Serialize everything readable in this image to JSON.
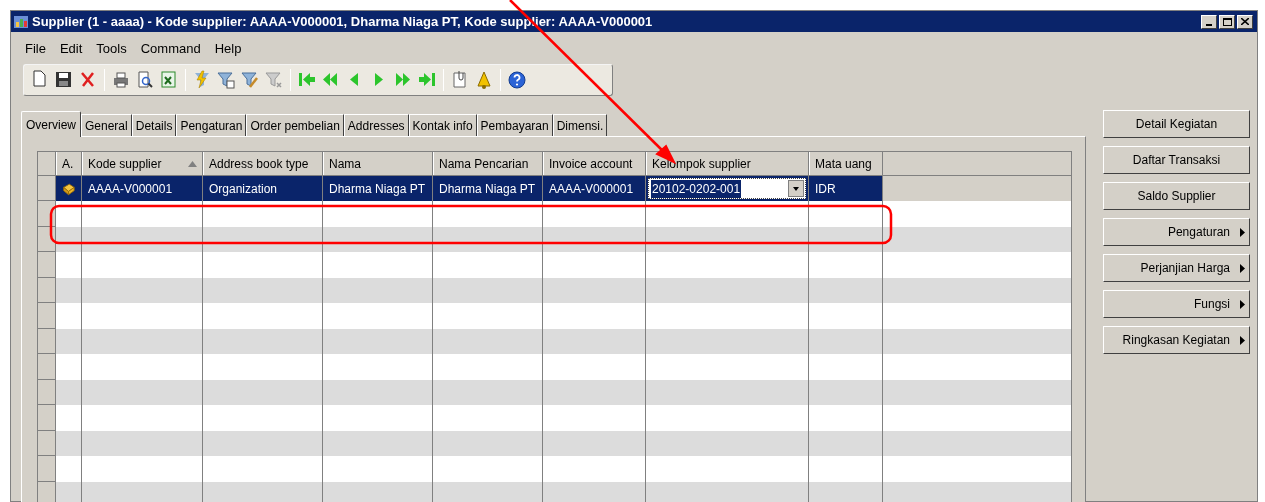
{
  "window": {
    "title": "Supplier (1 - aaaa) - Kode supplier: AAAA-V000001, Dharma Niaga PT, Kode supplier: AAAA-V000001"
  },
  "menu": [
    "File",
    "Edit",
    "Tools",
    "Command",
    "Help"
  ],
  "tabs": [
    {
      "label": "Overview",
      "selected": true
    },
    {
      "label": "General",
      "selected": false
    },
    {
      "label": "Details",
      "selected": false
    },
    {
      "label": "Pengaturan",
      "selected": false
    },
    {
      "label": "Order pembelian",
      "selected": false
    },
    {
      "label": "Addresses",
      "selected": false
    },
    {
      "label": "Kontak info",
      "selected": false
    },
    {
      "label": "Pembayaran",
      "selected": false
    },
    {
      "label": "Dimensi.",
      "selected": false
    }
  ],
  "table": {
    "columns": [
      {
        "label": "A.",
        "sorted": false
      },
      {
        "label": "Kode supplier",
        "sorted": true
      },
      {
        "label": "Address book type",
        "sorted": false
      },
      {
        "label": "Nama",
        "sorted": false
      },
      {
        "label": "Nama Pencarian",
        "sorted": false
      },
      {
        "label": "Invoice account",
        "sorted": false
      },
      {
        "label": "Kelompok supplier",
        "sorted": false
      },
      {
        "label": "Mata uang",
        "sorted": false
      }
    ],
    "rows": [
      {
        "selected": true,
        "cells": [
          "",
          "AAAA-V000001",
          "Organization",
          "Dharma Niaga PT",
          "Dharma Niaga PT",
          "AAAA-V000001",
          "20102-0202-001",
          "IDR"
        ]
      }
    ]
  },
  "buttons": [
    {
      "label": "Detail Kegiatan",
      "kind": "plain"
    },
    {
      "label": "Daftar Transaksi",
      "kind": "plain"
    },
    {
      "label": "Saldo Supplier",
      "kind": "plain"
    },
    {
      "label": "Pengaturan",
      "kind": "menu"
    },
    {
      "label": "Perjanjian Harga",
      "kind": "menu"
    },
    {
      "label": "Fungsi",
      "kind": "menu"
    },
    {
      "label": "Ringkasan Kegiatan",
      "kind": "menu"
    }
  ]
}
